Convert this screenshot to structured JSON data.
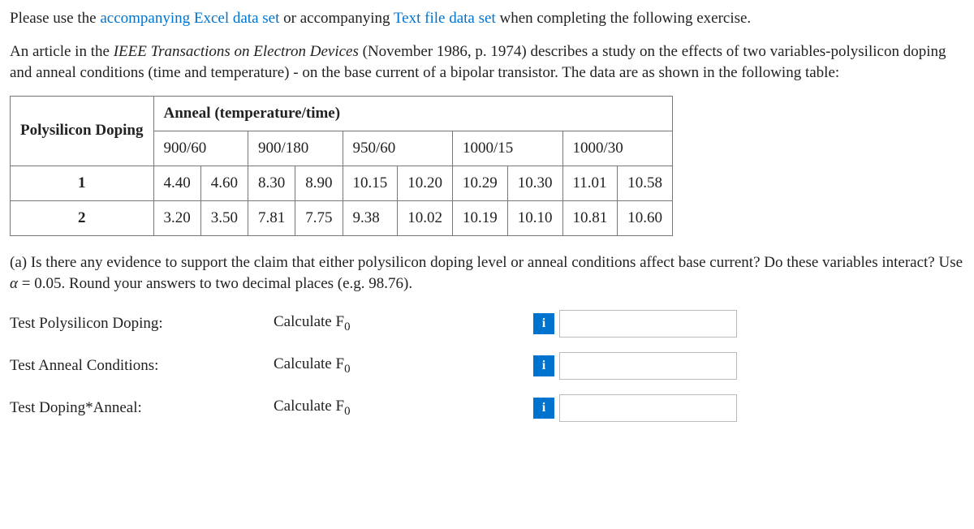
{
  "intro": {
    "prefix": "Please use the ",
    "link1": "accompanying Excel data set",
    "mid": " or accompanying ",
    "link2": "Text file data set",
    "suffix": " when completing the following exercise."
  },
  "article": {
    "prefix": "An article in the ",
    "journal": "IEEE Transactions on Electron Devices",
    "rest": " (November 1986, p. 1974) describes a study on the effects of two variables-polysilicon doping and anneal conditions (time and temperature) - on the base current of a bipolar transistor. The data are as shown in the following table:"
  },
  "table": {
    "rowhead": "Polysilicon Doping",
    "annealhead": "Anneal (temperature/time)",
    "cols": [
      "900/60",
      "900/180",
      "950/60",
      "1000/15",
      "1000/30"
    ],
    "levels": [
      "1",
      "2"
    ],
    "data": {
      "1": [
        [
          "4.40",
          "4.60"
        ],
        [
          "8.30",
          "8.90"
        ],
        [
          "10.15",
          "10.20"
        ],
        [
          "10.29",
          "10.30"
        ],
        [
          "11.01",
          "10.58"
        ]
      ],
      "2": [
        [
          "3.20",
          "3.50"
        ],
        [
          "7.81",
          "7.75"
        ],
        [
          "9.38",
          "10.02"
        ],
        [
          "10.19",
          "10.10"
        ],
        [
          "10.81",
          "10.60"
        ]
      ]
    }
  },
  "question_a": {
    "prefix": "(a) Is there any evidence to support the claim that either polysilicon doping level or anneal conditions affect base current? Do these variables interact? Use ",
    "alpha": "α",
    "eq": " = 0.05",
    "suffix": ". Round your answers to two decimal places (e.g. 98.76)."
  },
  "answers": {
    "r1": {
      "label": "Test Polysilicon Doping:",
      "calc_prefix": "Calculate F",
      "sub": "0",
      "value": ""
    },
    "r2": {
      "label": "Test Anneal Conditions:",
      "calc_prefix": "Calculate F",
      "sub": "0",
      "value": ""
    },
    "r3": {
      "label": "Test Doping*Anneal:",
      "calc_prefix": "Calculate F",
      "sub": "0",
      "value": ""
    }
  },
  "info_glyph": "i"
}
